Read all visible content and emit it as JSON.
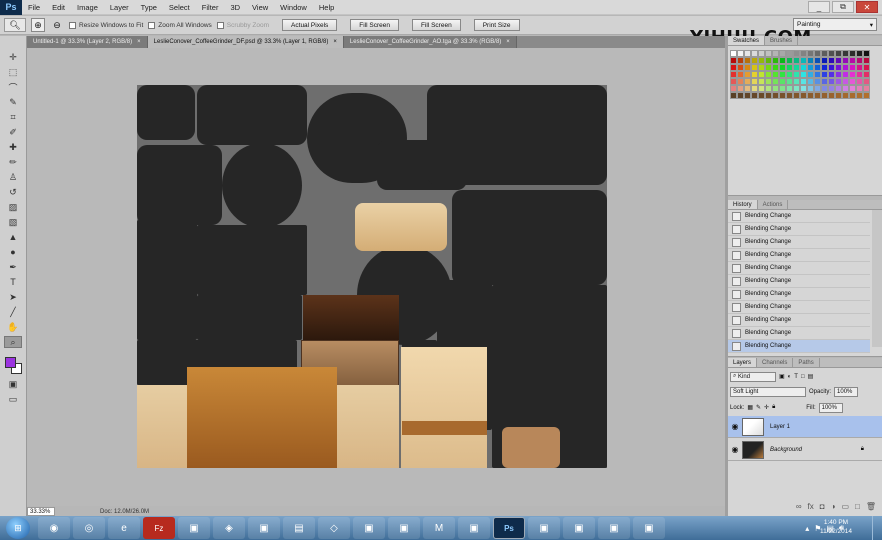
{
  "app": {
    "logo": "Ps"
  },
  "menu": [
    "File",
    "Edit",
    "Image",
    "Layer",
    "Type",
    "Select",
    "Filter",
    "3D",
    "View",
    "Window",
    "Help"
  ],
  "window_controls": {
    "minimize": "_",
    "restore": "⧉",
    "close": "✕"
  },
  "options": {
    "tool_icon": "zoom-icon",
    "resize_windows_label": "Resize Windows to Fit",
    "zoom_all_label": "Zoom All Windows",
    "scrubby_zoom_label": "Scrubby Zoom",
    "actual_pixels": "Actual Pixels",
    "fit_screen": "Fill Screen",
    "fill_screen": "Fill Screen",
    "print_size": "Print Size",
    "workspace": "Painting"
  },
  "tabs": [
    {
      "label": "Untitled-1 @ 33.3% (Layer 2, RGB/8)",
      "close": "×"
    },
    {
      "label": "LeslieConover_CoffeeGrinder_DF.psd @ 33.3% (Layer 1, RGB/8)",
      "close": "×"
    },
    {
      "label": "LeslieConover_CoffeeGrinder_AO.tga @ 33.3% (RGB/8)",
      "close": "×"
    }
  ],
  "status": {
    "zoom": "33.33%",
    "doc": "Doc: 12.0M/26.0M"
  },
  "watermark": "YIHUU.COM",
  "swatches_panel": {
    "tabs": [
      "Swatches",
      "Brushes"
    ]
  },
  "history_panel": {
    "tabs": [
      "History",
      "Actions"
    ],
    "items": [
      "Blending Change",
      "Blending Change",
      "Blending Change",
      "Blending Change",
      "Blending Change",
      "Blending Change",
      "Blending Change",
      "Blending Change",
      "Blending Change",
      "Blending Change",
      "Blending Change"
    ]
  },
  "layers_panel": {
    "tabs": [
      "Layers",
      "Channels",
      "Paths"
    ],
    "kind_filter": "Kind",
    "blend_mode": "Soft Light",
    "opacity_label": "Opacity:",
    "opacity_value": "100%",
    "lock_label": "Lock:",
    "fill_label": "Fill:",
    "fill_value": "100%",
    "layers": [
      {
        "name": "Layer 1",
        "selected": true
      },
      {
        "name": "Background",
        "selected": false
      }
    ]
  },
  "taskbar": {
    "apps": [
      "firefox-icon",
      "chrome-icon",
      "ie-icon",
      "filezilla-icon",
      "app-icon",
      "unity-icon",
      "app-icon",
      "folder-icon",
      "dropbox-icon",
      "app-icon",
      "app-icon",
      "maya-icon",
      "app-icon",
      "photoshop-icon",
      "app-icon",
      "app-icon",
      "app-icon",
      "app-icon"
    ],
    "time": "1:40 PM",
    "date": "11/22/2014"
  },
  "colors": {
    "foreground": "#9b34e0",
    "background": "#ffffff",
    "selection": "#a8c1ec"
  }
}
